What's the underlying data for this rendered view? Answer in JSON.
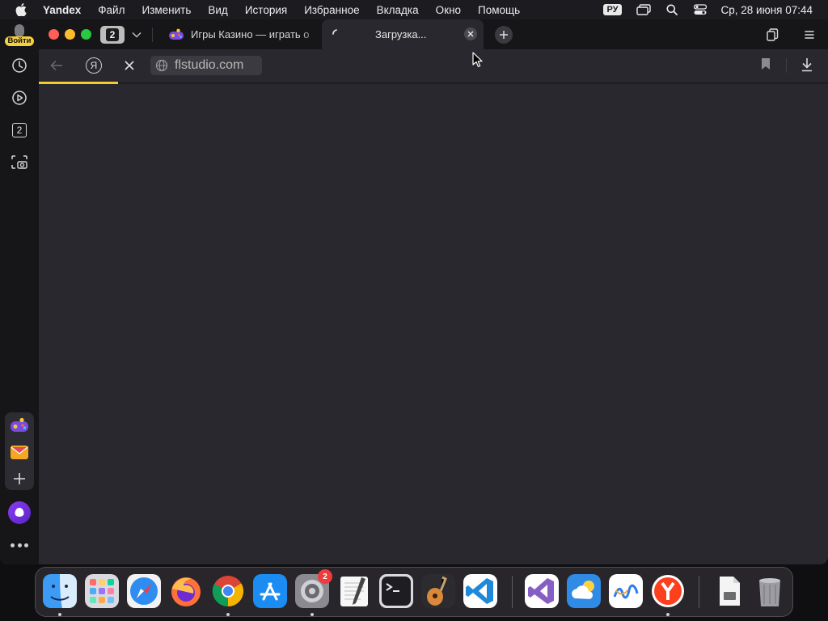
{
  "menubar": {
    "app_name": "Yandex",
    "menus": [
      "Файл",
      "Изменить",
      "Вид",
      "История",
      "Избранное",
      "Вкладка",
      "Окно",
      "Помощь"
    ],
    "language": "РУ",
    "datetime": "Ср, 28 июня  07:44"
  },
  "sidebar": {
    "login_label": "Войти",
    "counter_value": "2"
  },
  "tabbar": {
    "tab_count": "2",
    "tabs": [
      {
        "title": "Игры Казино — играть о",
        "active": false,
        "icon": "gamepad-icon"
      },
      {
        "title": "Загрузка...",
        "active": true,
        "icon": "loading-spinner-icon"
      }
    ]
  },
  "addressbar": {
    "url": "flstudio.com",
    "load_progress": 0.1
  },
  "colors": {
    "accent_yellow": "#f4cd2c",
    "window_bg": "#28282e",
    "sidebar_bg": "#161618"
  },
  "dock": {
    "apps": [
      {
        "name": "Finder",
        "icon": "finder-icon",
        "running": true
      },
      {
        "name": "Launchpad",
        "icon": "launchpad-icon",
        "running": false
      },
      {
        "name": "Safari",
        "icon": "safari-icon",
        "running": false
      },
      {
        "name": "Firefox",
        "icon": "firefox-icon",
        "running": false
      },
      {
        "name": "Chrome",
        "icon": "chrome-icon",
        "running": true
      },
      {
        "name": "App Store",
        "icon": "appstore-icon",
        "running": false
      },
      {
        "name": "System Settings",
        "icon": "settings-icon",
        "running": true,
        "badge": "2"
      },
      {
        "name": "TextEdit",
        "icon": "textedit-icon",
        "running": false
      },
      {
        "name": "Terminal",
        "icon": "terminal-icon",
        "running": false
      },
      {
        "name": "GarageBand",
        "icon": "garageband-icon",
        "running": false
      },
      {
        "name": "VS Code",
        "icon": "vscode-icon",
        "running": false
      },
      {
        "name": "Visual Studio",
        "icon": "visualstudio-icon",
        "running": false
      },
      {
        "name": "Weather",
        "icon": "weather-icon",
        "running": false
      },
      {
        "name": "Freeform",
        "icon": "freeform-icon",
        "running": false
      },
      {
        "name": "Yandex Browser",
        "icon": "yandex-browser-icon",
        "running": true
      },
      {
        "name": "Document",
        "icon": "document-icon",
        "running": false
      },
      {
        "name": "Trash",
        "icon": "trash-icon",
        "running": false
      }
    ]
  }
}
